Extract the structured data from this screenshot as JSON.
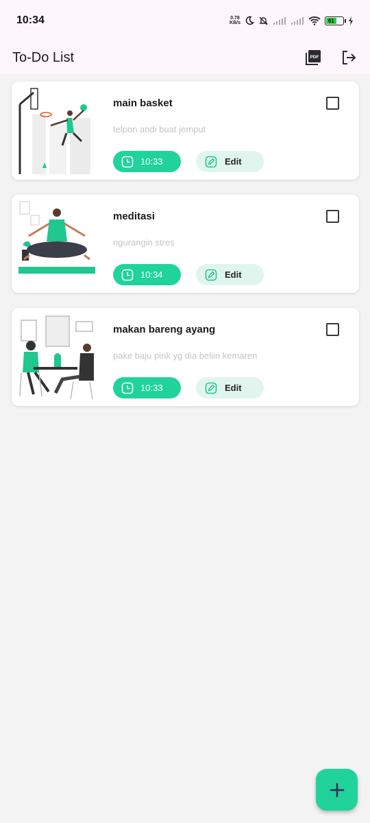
{
  "status_bar": {
    "time": "10:34",
    "net_speed_value": "0.78",
    "net_speed_unit": "KB/s",
    "battery": "61"
  },
  "app_bar": {
    "title": "To-Do List",
    "pdf_label": "PDF"
  },
  "tasks": [
    {
      "title": "main basket",
      "description": "telpon andi buat jemput",
      "time": "10:33",
      "edit_label": "Edit",
      "checked": false
    },
    {
      "title": "meditasi",
      "description": "ngurangin stres",
      "time": "10:34",
      "edit_label": "Edit",
      "checked": false
    },
    {
      "title": "makan bareng ayang",
      "description": "pake baju pink yg dia beliin kemaren",
      "time": "10:33",
      "edit_label": "Edit",
      "checked": false
    }
  ],
  "colors": {
    "accent": "#20d39b",
    "accent_light": "#e0f5ee",
    "app_bar_bg": "#fdf6fd",
    "page_bg": "#f3f3f3"
  },
  "icons": {
    "pdf": "pdf-icon",
    "logout": "logout-icon",
    "clock": "clock-icon",
    "edit": "edit-icon",
    "add": "plus-icon"
  }
}
